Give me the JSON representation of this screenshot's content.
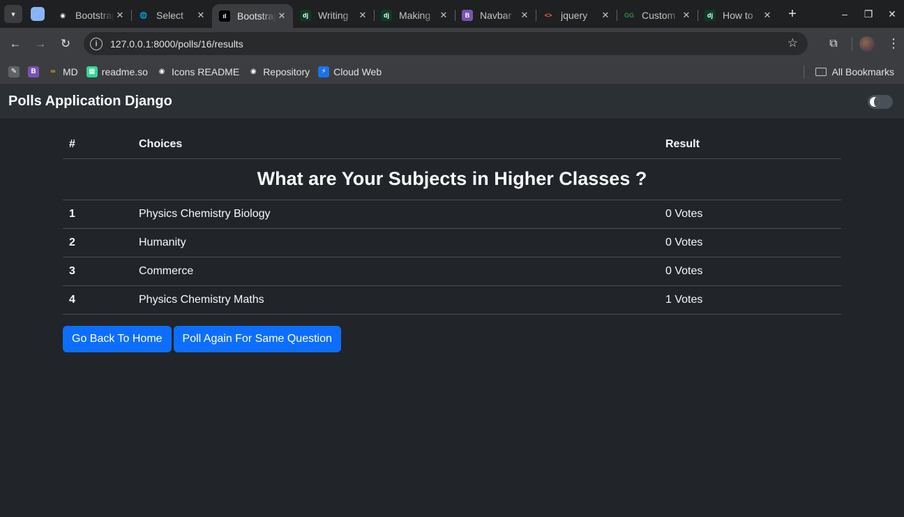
{
  "browser": {
    "tabs": [
      {
        "title": "Bootstrap",
        "icon": "github-icon",
        "fav_bg": "#1f2021",
        "fav_fg": "#ffffff",
        "glyph": "◉",
        "active": false
      },
      {
        "title": "Select",
        "icon": "globe-icon",
        "fav_bg": "#1f2021",
        "fav_fg": "#c4c7c5",
        "glyph": "🌐",
        "active": false
      },
      {
        "title": "Bootstrap",
        "icon": "chart-icon",
        "fav_bg": "#000000",
        "fav_fg": "#ffffff",
        "glyph": "ıl",
        "active": true
      },
      {
        "title": "Writing",
        "icon": "django-icon",
        "fav_bg": "#0c3c26",
        "fav_fg": "#ffffff",
        "glyph": "dj",
        "active": false
      },
      {
        "title": "Making",
        "icon": "django-icon",
        "fav_bg": "#0c3c26",
        "fav_fg": "#ffffff",
        "glyph": "dj",
        "active": false
      },
      {
        "title": "Navbar",
        "icon": "bootstrap-icon",
        "fav_bg": "#7952b3",
        "fav_fg": "#ffffff",
        "glyph": "B",
        "active": false
      },
      {
        "title": "jquery",
        "icon": "code-icon",
        "fav_bg": "#1f2021",
        "fav_fg": "#f26b3a",
        "glyph": "<>",
        "active": false
      },
      {
        "title": "Custom",
        "icon": "geeks-icon",
        "fav_bg": "#1f2021",
        "fav_fg": "#2f8d46",
        "glyph": "GG",
        "active": false
      },
      {
        "title": "How to",
        "icon": "django-icon",
        "fav_bg": "#0c3c26",
        "fav_fg": "#ffffff",
        "glyph": "dj",
        "active": false
      }
    ],
    "url": "127.0.0.1:8000/polls/16/results",
    "bookmarks": [
      {
        "label": "",
        "icon": "notes-icon",
        "bg": "#5f6368",
        "glyph": "✎"
      },
      {
        "label": "",
        "icon": "bootstrap-icon",
        "bg": "#7952b3",
        "glyph": "B"
      },
      {
        "label": "MD",
        "icon": "infinity-icon",
        "bg": "transparent",
        "glyph": "∞"
      },
      {
        "label": "readme.so",
        "icon": "readme-icon",
        "bg": "#34d399",
        "glyph": "▦"
      },
      {
        "label": "Icons README",
        "icon": "github-icon",
        "bg": "transparent",
        "glyph": "◉"
      },
      {
        "label": "Repository",
        "icon": "github-icon",
        "bg": "transparent",
        "glyph": "◉"
      },
      {
        "label": "Cloud Web",
        "icon": "bolt-icon",
        "bg": "#1a73e8",
        "glyph": "⚡"
      }
    ],
    "all_bookmarks": "All Bookmarks"
  },
  "navbar": {
    "brand": "Polls Application Django"
  },
  "table": {
    "headers": [
      "#",
      "Choices",
      "Result"
    ],
    "question": "What are Your Subjects in Higher Classes ?",
    "rows": [
      {
        "num": "1",
        "choice": "Physics Chemistry Biology",
        "result": "0 Votes"
      },
      {
        "num": "2",
        "choice": "Humanity",
        "result": "0 Votes"
      },
      {
        "num": "3",
        "choice": "Commerce",
        "result": "0 Votes"
      },
      {
        "num": "4",
        "choice": "Physics Chemistry Maths",
        "result": "1 Votes"
      }
    ]
  },
  "buttons": {
    "home": "Go Back To Home",
    "poll_again": "Poll Again For Same Question"
  },
  "colors": {
    "accent": "#0d6efd",
    "background": "#212529",
    "navbar": "#2b3035"
  }
}
